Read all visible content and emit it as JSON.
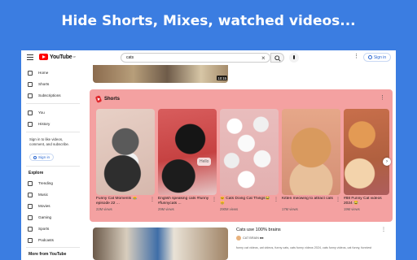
{
  "banner": {
    "title": "Hide Shorts, Mixes, watched videos..."
  },
  "topbar": {
    "logo_text": "YouTube",
    "logo_sup": "JP",
    "search_value": "cats",
    "clear_label": "×",
    "more_label": "⋮",
    "signin_label": "Sign in"
  },
  "sidebar": {
    "items_top": [
      {
        "label": "Home",
        "icon": "home-icon"
      },
      {
        "label": "Shorts",
        "icon": "shorts-icon"
      },
      {
        "label": "Subscriptions",
        "icon": "subscriptions-icon"
      }
    ],
    "items_you": [
      {
        "label": "You",
        "icon": "you-icon"
      },
      {
        "label": "History",
        "icon": "history-icon"
      }
    ],
    "signin_text": "Sign in to like videos, comment, and subscribe.",
    "signin_label": "Sign in",
    "explore_heading": "Explore",
    "explore_items": [
      {
        "label": "Trending",
        "icon": "trending-icon"
      },
      {
        "label": "Music",
        "icon": "music-icon"
      },
      {
        "label": "Movies",
        "icon": "movies-icon"
      },
      {
        "label": "Gaming",
        "icon": "gaming-icon"
      },
      {
        "label": "Sports",
        "icon": "sports-icon"
      },
      {
        "label": "Podcasts",
        "icon": "podcasts-icon"
      }
    ],
    "more_heading": "More from YouTube"
  },
  "main": {
    "prev_duration": "10:15",
    "shorts": {
      "title": "Shorts",
      "more_label": "⋮",
      "cards": [
        {
          "title": "Funny Cat Moments 😹 episode 22 ...",
          "views": "22M views"
        },
        {
          "title": "English speaking cats #funny #funnycats ...",
          "views": "29M views"
        },
        {
          "title": "🐱 Cats Doing Cat Things😂 😸",
          "views": "290M views"
        },
        {
          "title": "Kitten meowing to attract cats",
          "views": "17M views"
        },
        {
          "title": "#88 Funny Cat videos 2024 😂",
          "views": "19M views"
        }
      ],
      "hello_label": "Hello",
      "scroll_arrow": "›"
    },
    "video": {
      "title": "Cats use 100% brains",
      "channel": "CAT BRAIN ■■",
      "description": "funny cat videos, cat videos, funny cats, cats funny videos 2024, cats funny videos, cat funny, funniest",
      "more_label": "⋮"
    }
  },
  "colors": {
    "background": "#3b7de1",
    "shorts_highlight": "#f4a1a1",
    "accent": "#2866d1"
  }
}
